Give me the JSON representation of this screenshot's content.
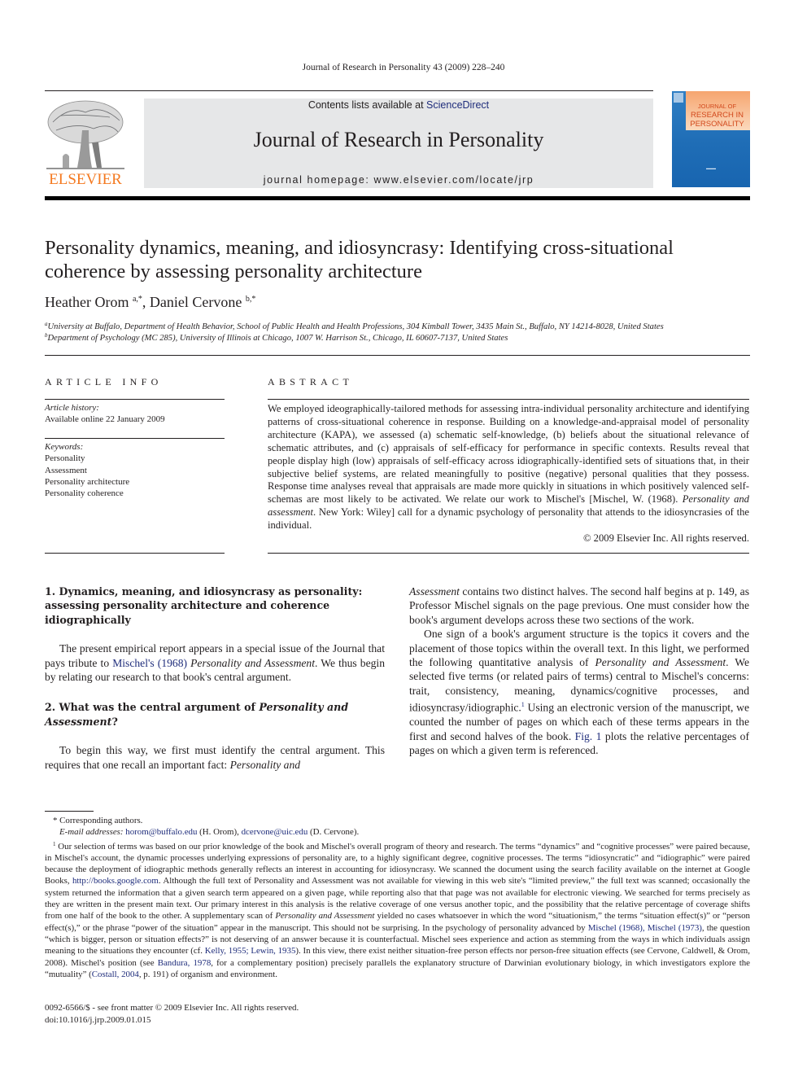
{
  "running_head": "Journal of Research in Personality 43 (2009) 228–240",
  "masthead": {
    "publisher_logo": "ELSEVIER",
    "contents_prefix": "Contents lists available at ",
    "contents_link": "ScienceDirect",
    "journal_title": "Journal of Research in Personality",
    "homepage": "journal homepage: www.elsevier.com/locate/jrp",
    "cover": {
      "line1": "JOURNAL OF",
      "line2": "RESEARCH IN",
      "line3": "PERSONALITY",
      "colors": {
        "blue": "#1f6db6",
        "orange": "#f6a56f"
      }
    },
    "logo_color": "#f47920"
  },
  "article": {
    "title": "Personality dynamics, meaning, and idiosyncrasy: Identifying cross-situational coherence by assessing personality architecture",
    "authors": [
      {
        "name": "Heather Orom",
        "marks": "a,*"
      },
      {
        "name": "Daniel Cervone",
        "marks": "b,*"
      }
    ],
    "author_separator": ", ",
    "affiliations": [
      {
        "mark": "a",
        "text": "University at Buffalo, Department of Health Behavior, School of Public Health and Health Professions, 304 Kimball Tower, 3435 Main St., Buffalo, NY 14214-8028, United States"
      },
      {
        "mark": "b",
        "text": "Department of Psychology (MC 285), University of Illinois at Chicago, 1007 W. Harrison St., Chicago, IL 60607-7137, United States"
      }
    ]
  },
  "article_info": {
    "heading": "ARTICLE INFO",
    "history_label": "Article history:",
    "history_value": "Available online 22 January 2009",
    "keywords_label": "Keywords:",
    "keywords": [
      "Personality",
      "Assessment",
      "Personality architecture",
      "Personality coherence"
    ]
  },
  "abstract": {
    "heading": "ABSTRACT",
    "text_before_italic": "We employed ideographically-tailored methods for assessing intra-individual personality architecture and identifying patterns of cross-situational coherence in response. Building on a knowledge-and-appraisal model of personality architecture (KAPA), we assessed (a) schematic self-knowledge, (b) beliefs about the situational relevance of schematic attributes, and (c) appraisals of self-efficacy for performance in specific contexts. Results reveal that people display high (low) appraisals of self-efficacy across idiographically-identified sets of situations that, in their subjective belief systems, are related meaningfully to positive (negative) personal qualities that they possess. Response time analyses reveal that appraisals are made more quickly in situations in which positively valenced self-schemas are most likely to be activated. We relate our work to Mischel's [Mischel, W. (1968). ",
    "italic": "Personality and assessment",
    "text_after_italic": ". New York: Wiley] call for a dynamic psychology of personality that attends to the idiosyncrasies of the individual.",
    "copyright": "© 2009 Elsevier Inc. All rights reserved."
  },
  "body": {
    "section1": {
      "heading": "1. Dynamics, meaning, and idiosyncrasy as personality: assessing personality architecture and coherence idiographically",
      "p1_a": "The present empirical report appears in a special issue of the Journal that pays tribute to ",
      "p1_link": "Mischel's (1968)",
      "p1_italic": " Personality and Assessment",
      "p1_b": ". We thus begin by relating our research to that book's central argument."
    },
    "section2": {
      "heading_a": "2. What was the central argument of ",
      "heading_italic": "Personality and Assessment",
      "heading_b": "?",
      "p1_a": "To begin this way, we first must identify the central argument. This requires that one recall an important fact: ",
      "p1_italic": "Personality and"
    },
    "right_col": {
      "p1_italic": "Assessment",
      "p1_a": " contains two distinct halves. The second half begins at p. 149, as Professor Mischel signals on the page previous. One must consider how the book's argument develops across these two sections of the work.",
      "p2_a": "One sign of a book's argument structure is the topics it covers and the placement of those topics within the overall text. In this light, we performed the following quantitative analysis of ",
      "p2_italic": "Personality and Assessment",
      "p2_b": ". We selected five terms (or related pairs of terms) central to Mischel's concerns: trait, consistency, meaning, dynamics/cognitive processes, and idiosyncrasy/idiographic.",
      "p2_fn": "1",
      "p2_c": " Using an electronic version of the manuscript, we counted the number of pages on which each of these terms appears in the first and second halves of the book. ",
      "p2_link": "Fig. 1",
      "p2_d": " plots the relative percentages of pages on which a given term is referenced."
    }
  },
  "footnotes": {
    "corresponding": "* Corresponding authors.",
    "email_label": "E-mail addresses: ",
    "email1": "horom@buffalo.edu",
    "email1_who": " (H. Orom), ",
    "email2": "dcervone@uic.edu",
    "email2_who": " (D. Cervone).",
    "fn1_mark": "1",
    "fn1_a": " Our selection of terms was based on our prior knowledge of the book and Mischel's overall program of theory and research. The terms “dynamics” and “cognitive processes” were paired because, in Mischel's account, the dynamic processes underlying expressions of personality are, to a highly significant degree, cognitive processes. The terms “idiosyncratic” and “idiographic” were paired because the deployment of idiographic methods generally reflects an interest in accounting for idiosyncrasy. We scanned the document using the search facility available on the internet at Google Books, ",
    "fn1_link1": "http://books.google.com",
    "fn1_b": ". Although the full text of Personality and Assessment was not available for viewing in this web site's “limited preview,” the full text was scanned; occasionally the system returned the information that a given search term appeared on a given page, while reporting also that that page was not available for electronic viewing. We searched for terms precisely as they are written in the present main text. Our primary interest in this analysis is the relative coverage of one versus another topic, and the possibility that the relative percentage of coverage shifts from one half of the book to the other. A supplementary scan of ",
    "fn1_italic": "Personality and Assessment",
    "fn1_c": " yielded no cases whatsoever in which the word “situationism,” the terms “situation effect(s)” or “person effect(s),” or the phrase “power of the situation” appear in the manuscript. This should not be surprising. In the psychology of personality advanced by ",
    "fn1_link2": "Mischel (1968), Mischel (1973)",
    "fn1_d": ", the question “which is bigger, person or situation effects?” is not deserving of an answer because it is counterfactual. Mischel sees experience and action as stemming from the ways in which individuals assign meaning to the situations they encounter (cf. ",
    "fn1_link3": "Kelly, 1955; Lewin, 1935",
    "fn1_e": "). In this view, there exist neither situation-free person effects nor person-free situation effects (see Cervone, Caldwell, & Orom, 2008). Mischel's position (see ",
    "fn1_link4": "Bandura, 1978",
    "fn1_f": ", for a complementary position) precisely parallels the explanatory structure of Darwinian evolutionary biology, in which investigators explore the “mutuality” (",
    "fn1_link5": "Costall, 2004",
    "fn1_g": ", p. 191) of organism and environment."
  },
  "bottom": {
    "front_matter": "0092-6566/$ - see front matter © 2009 Elsevier Inc. All rights reserved.",
    "doi": "doi:10.1016/j.jrp.2009.01.015"
  }
}
